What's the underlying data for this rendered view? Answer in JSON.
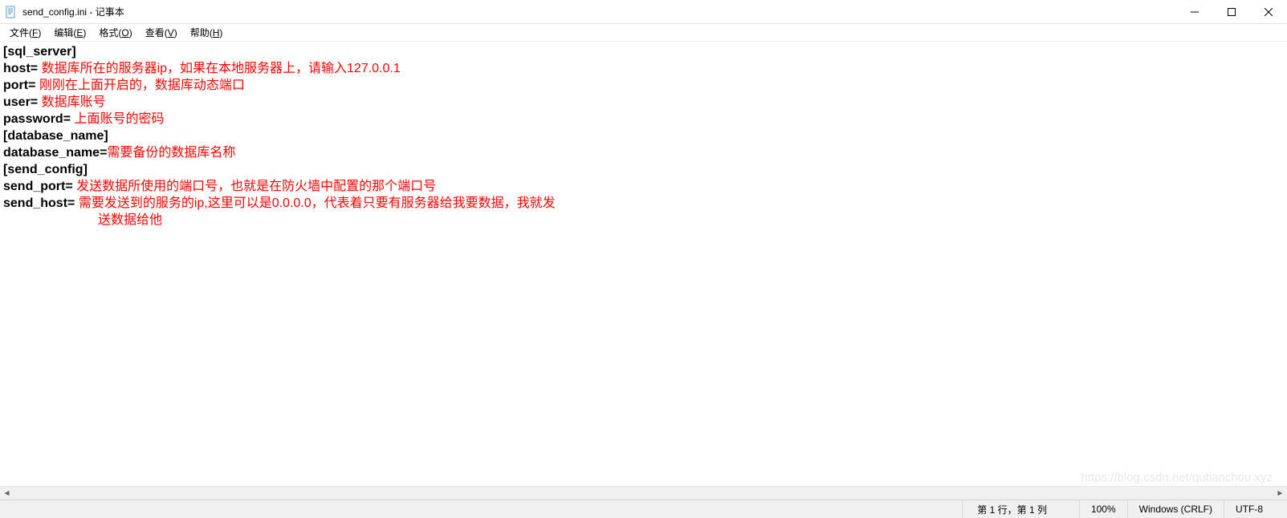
{
  "titlebar": {
    "title": "send_config.ini - 记事本"
  },
  "menu": {
    "file": "文件(F)",
    "edit": "编辑(E)",
    "format": "格式(O)",
    "view": "查看(V)",
    "help": "帮助(H)"
  },
  "content": {
    "section1": "[sql_server]",
    "host_key": "host= ",
    "host_val": "数据库所在的服务器ip，如果在本地服务器上，请输入127.0.0.1",
    "port_key": "port= ",
    "port_val": "刚刚在上面开启的，数据库动态端口",
    "user_key": "user= ",
    "user_val": "数据库账号",
    "password_key": "password= ",
    "password_val": "上面账号的密码",
    "section2": "[database_name]",
    "dbname_key": "database_name=",
    "dbname_val": "需要备份的数据库名称",
    "section3": "[send_config]",
    "sendport_key": "send_port= ",
    "sendport_val": "发送数据所使用的端口号，也就是在防火墙中配置的那个端口号",
    "sendhost_key": "send_host= ",
    "sendhost_val1": "需要发送到的服务的ip,这里可以是0.0.0.0，代表着只要有服务器给我要数据，我就发",
    "sendhost_val2": "送数据给他"
  },
  "statusbar": {
    "position": "第 1 行，第 1 列",
    "zoom": "100%",
    "lineending": "Windows (CRLF)",
    "encoding": "UTF-8"
  },
  "watermark": "https://blog.csdn.net/qutianchou.xyz"
}
